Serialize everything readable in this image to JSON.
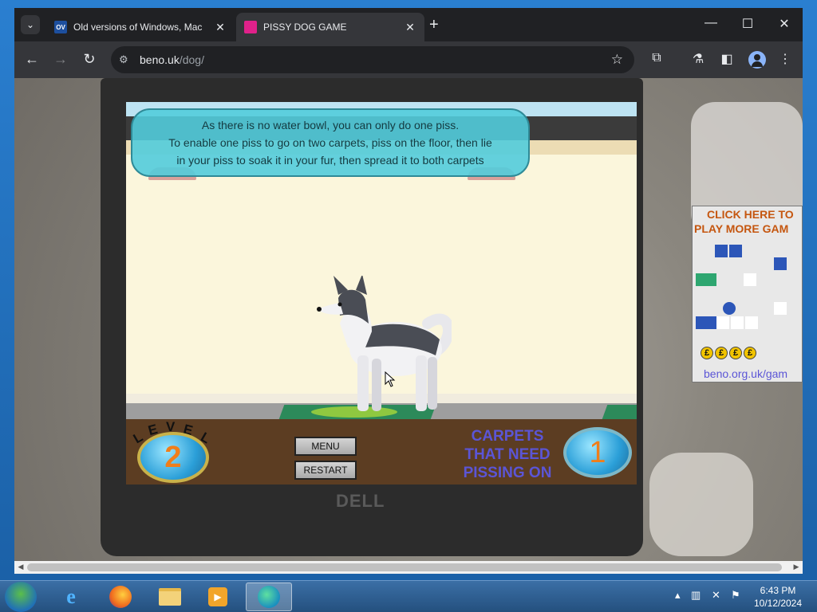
{
  "browser": {
    "tabs": [
      {
        "title": "Old versions of Windows, Mac",
        "favicon": "OV",
        "active": false
      },
      {
        "title": "PISSY DOG GAME",
        "favicon": "",
        "active": true
      }
    ],
    "new_tab": "+",
    "url_host": "beno.uk",
    "url_path": "/dog/"
  },
  "game": {
    "instructions": [
      "As there is no water bowl, you can only do one piss.",
      "To enable one piss to go on two carpets, piss on the floor, then lie",
      "in your piss to soak it in your fur, then spread it to both carpets"
    ],
    "level_word": "LEVEL",
    "level_number": "2",
    "menu_label": "MENU",
    "restart_label": "RESTART",
    "carpets_label_lines": [
      "CARPETS",
      "THAT NEED",
      "PISSING ON"
    ],
    "carpets_count": "1"
  },
  "ad": {
    "line1": "CLICK HERE TO",
    "line2": "PLAY MORE GAM",
    "url": "beno.org.uk/gam",
    "coin_symbol": "£"
  },
  "laptop_brand": "DELL",
  "taskbar": {
    "time": "6:43 PM",
    "date": "10/12/2024"
  }
}
